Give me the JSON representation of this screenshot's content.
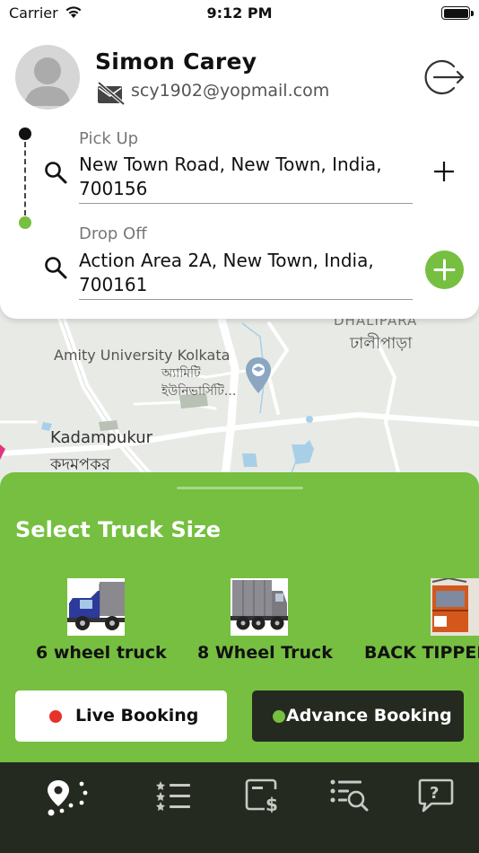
{
  "status_bar": {
    "carrier": "Carrier",
    "time": "9:12 PM"
  },
  "user": {
    "name": "Simon Carey",
    "email": "scy1902@yopmail.com"
  },
  "pickup": {
    "label": "Pick Up",
    "address": "New Town Road, New Town, India, 700156"
  },
  "dropoff": {
    "label": "Drop Off",
    "address": "Action Area 2A, New Town, India, 700161"
  },
  "map": {
    "labels": {
      "amity": "Amity University Kolkata",
      "amity_bn": "অ্যামিটি ইউনিভার্সিটি...",
      "kadampukur": "Kadampukur",
      "kadampukur_bn": "কদমপকর",
      "dhalipara": "DHALIPARA",
      "dhalipara_bn": "ঢালীপাড়া"
    }
  },
  "sheet": {
    "title": "Select Truck Size",
    "trucks": [
      {
        "name": "6 wheel truck",
        "icon": "blue-truck-image"
      },
      {
        "name": "8 Wheel Truck",
        "icon": "grey-truck-image"
      },
      {
        "name": "BACK TIPPER",
        "icon": "orange-tipper-image"
      }
    ],
    "live_booking": "Live Booking",
    "advance_booking": "Advance Booking"
  },
  "tabbar": {
    "tabs": [
      {
        "icon": "route-map-icon"
      },
      {
        "icon": "rated-list-icon"
      },
      {
        "icon": "payment-icon"
      },
      {
        "icon": "search-list-icon"
      },
      {
        "icon": "help-icon"
      }
    ]
  },
  "colors": {
    "accent_green": "#76bf40",
    "dark": "#252a21",
    "live_dot": "#e5332a"
  }
}
